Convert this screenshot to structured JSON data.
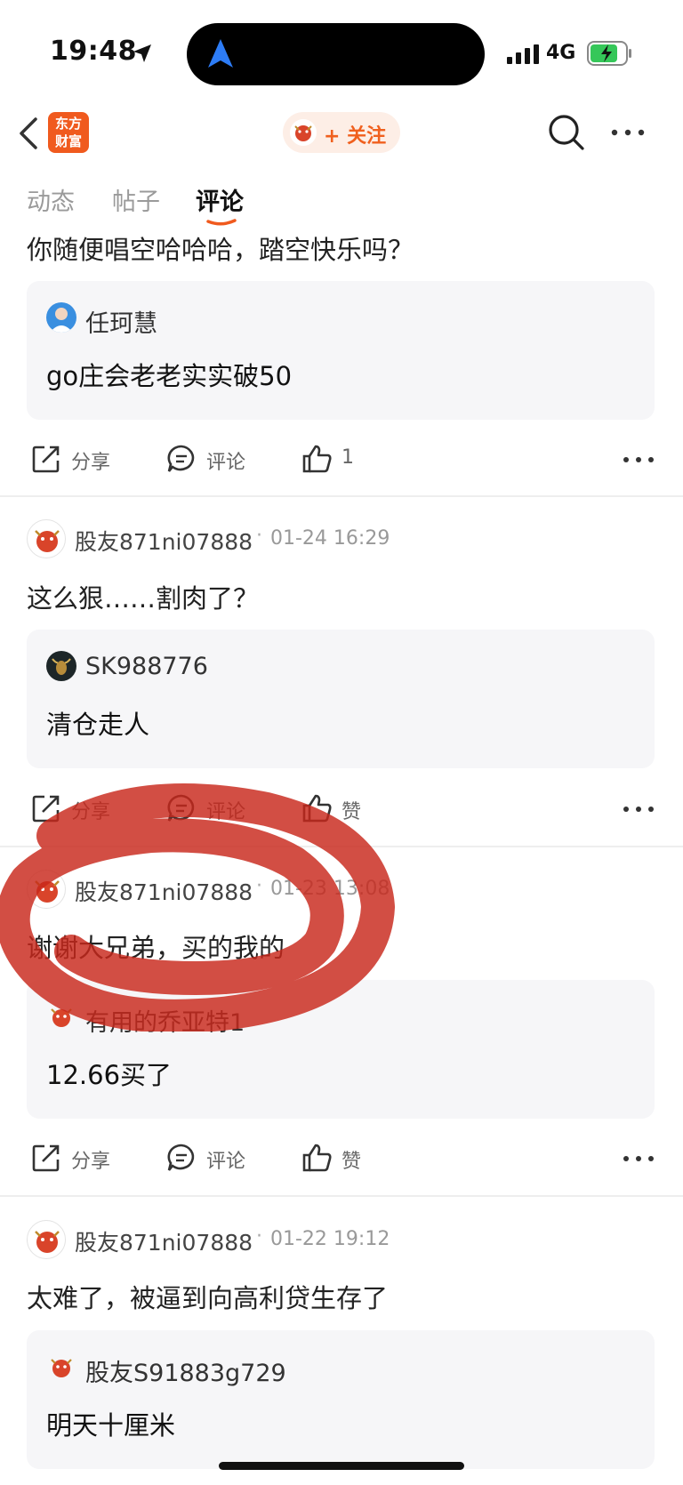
{
  "status_bar": {
    "time": "19:48",
    "network": "4G"
  },
  "nav": {
    "logo_line1": "东方",
    "logo_line2": "财富",
    "follow_label": "+ 关注"
  },
  "tabs": [
    {
      "label": "动态"
    },
    {
      "label": "帖子"
    },
    {
      "label": "评论"
    }
  ],
  "posts": [
    {
      "text": "你随便唱空哈哈哈，踏空快乐吗？",
      "quote": {
        "user": "任珂慧",
        "text": "go庄会老老实实破50"
      },
      "share": "分享",
      "comment": "评论",
      "like": "1"
    },
    {
      "user": "股友871ni07888",
      "time": "01-24 16:29",
      "text": "这么狠……割肉了？",
      "quote": {
        "user": "SK988776",
        "text": "清仓走人"
      },
      "share": "分享",
      "comment": "评论",
      "like": "赞"
    },
    {
      "user": "股友871ni07888",
      "time": "01-23 13:08",
      "text": "谢谢大兄弟，买的我的",
      "quote": {
        "user": "有用的乔亚特1",
        "text": "12.66买了"
      },
      "share": "分享",
      "comment": "评论",
      "like": "赞"
    },
    {
      "user": "股友871ni07888",
      "time": "01-22 19:12",
      "text": "太难了，被逼到向高利贷生存了",
      "quote": {
        "user": "股友S91883g729",
        "text": "明天十厘米"
      }
    }
  ],
  "colors": {
    "accent": "#f05a1e",
    "annotation": "#c8271b"
  }
}
